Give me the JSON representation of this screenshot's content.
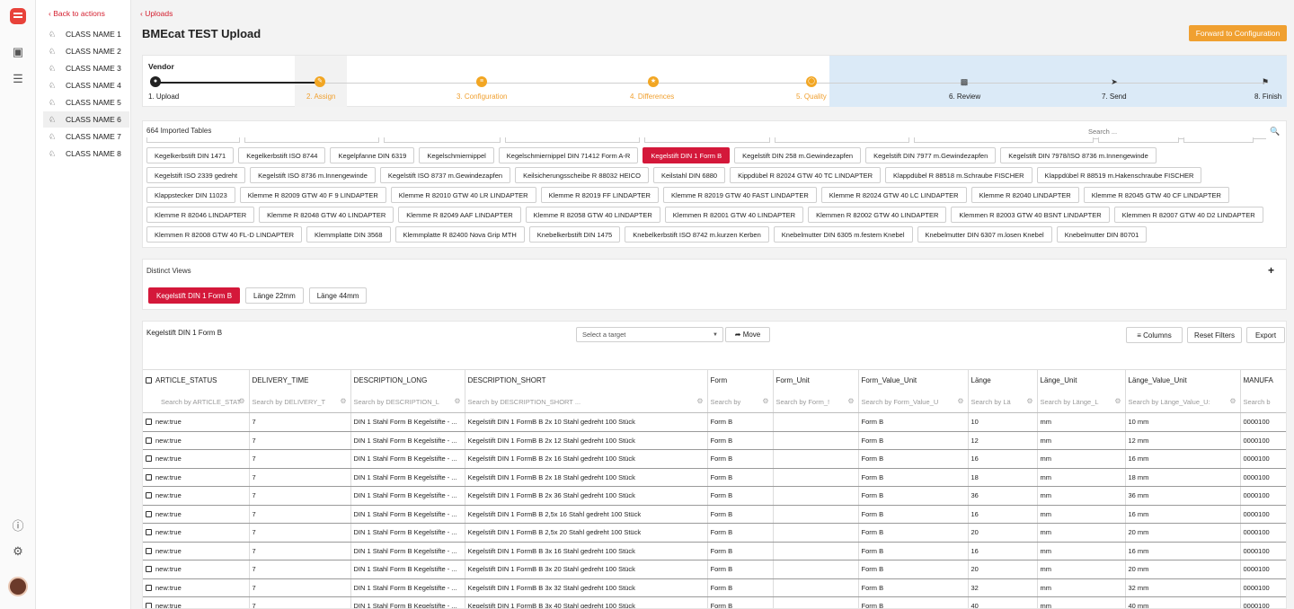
{
  "sidebar": {
    "back_label": "‹ Back to actions",
    "classes": [
      "CLASS NAME 1",
      "CLASS NAME 2",
      "CLASS NAME 3",
      "CLASS NAME 4",
      "CLASS NAME 5",
      "CLASS NAME 6",
      "CLASS NAME 7",
      "CLASS NAME 8"
    ],
    "active_class": "CLASS NAME 6"
  },
  "header": {
    "uploads_link": "‹ Uploads",
    "title": "BMEcat TEST Upload",
    "forward_button": "Forward to Configuration"
  },
  "stepper": {
    "vendor_label": "Vendor",
    "steps": [
      "1. Upload",
      "2. Assign",
      "3. Configuration",
      "4. Differences",
      "5. Quality",
      "6. Review",
      "7. Send",
      "8. Finish"
    ]
  },
  "tables": {
    "header": "664 Imported Tables",
    "search_placeholder": "Search ...",
    "rows": [
      [
        "Kegelkerbstift DIN 1471",
        "Kegelkerbstift ISO 8744",
        "Kegelpfanne DIN 6319",
        "Kegelschmiernippel",
        "Kegelschmiernippel DIN 71412 Form A-R",
        "Kegelstift DIN 1 Form B",
        "Kegelstift DIN 258 m.Gewindezapfen",
        "Kegelstift DIN 7977 m.Gewindezapfen",
        "Kegelstift DIN 7978/ISO 8736 m.Innengewinde"
      ],
      [
        "Kegelstift ISO 2339 gedreht",
        "Kegelstift ISO 8736 m.Innengewinde",
        "Kegelstift ISO 8737 m.Gewindezapfen",
        "Keilsicherungsscheibe R 88032 HEICO",
        "Keilstahl DIN 6880",
        "Kippdübel R 82024 GTW 40 TC LINDAPTER",
        "Klappdübel R 88518 m.Schraube FISCHER",
        "Klappdübel R 88519 m.Hakenschraube FISCHER"
      ],
      [
        "Klappstecker DIN 11023",
        "Klemme R 82009 GTW 40 F 9 LINDAPTER",
        "Klemme R 82010 GTW 40 LR LINDAPTER",
        "Klemme R 82019 FF LINDAPTER",
        "Klemme R 82019 GTW 40 FAST LINDAPTER",
        "Klemme R 82024 GTW 40 LC LINDAPTER",
        "Klemme R 82040 LINDAPTER",
        "Klemme R 82045 GTW 40 CF LINDAPTER"
      ],
      [
        "Klemme R 82046 LINDAPTER",
        "Klemme R 82048 GTW 40 LINDAPTER",
        "Klemme R 82049 AAF LINDAPTER",
        "Klemme R 82058 GTW 40 LINDAPTER",
        "Klemmen R 82001 GTW 40 LINDAPTER",
        "Klemmen R 82002 GTW 40 LINDAPTER",
        "Klemmen R 82003 GTW 40 BSNT LINDAPTER",
        "Klemmen R 82007 GTW 40 D2 LINDAPTER"
      ],
      [
        "Klemmen R 82008 GTW 40 FL-D LINDAPTER",
        "Klemmplatte DIN 3568",
        "Klemmplatte R 82400 Nova Grip MTH",
        "Knebelkerbstift DIN 1475",
        "Knebelkerbstift ISO 8742 m.kurzen Kerben",
        "Knebelmutter DIN 6305 m.festem Knebel",
        "Knebelmutter DIN 6307 m.losen Knebel",
        "Knebelmutter DIN 80701"
      ]
    ],
    "active_tag": "Kegelstift DIN 1 Form B"
  },
  "views": {
    "header": "Distinct Views",
    "add_icon": "+",
    "buttons": [
      "Kegelstift DIN 1 Form B",
      "Länge 22mm",
      "Länge 44mm"
    ]
  },
  "grid": {
    "title": "Kegelstift DIN 1 Form B",
    "target_placeholder": "Select a target",
    "move_label": "Move",
    "columns_label": "Columns",
    "reset_label": "Reset Filters",
    "export_label": "Export",
    "columns": [
      "ARTICLE_STATUS",
      "DELIVERY_TIME",
      "DESCRIPTION_LONG",
      "DESCRIPTION_SHORT",
      "Form",
      "Form_Unit",
      "Form_Value_Unit",
      "Länge",
      "Länge_Unit",
      "Länge_Value_Unit",
      "MANUFA"
    ],
    "filters": [
      "Search by ARTICLE_STAT",
      "Search by DELIVERY_T",
      "Search by DESCRIPTION_L",
      "Search by DESCRIPTION_SHORT ...",
      "Search by",
      "Search by Form_!",
      "Search by Form_Value_U",
      "Search by Lä",
      "Search by Länge_L",
      "Search by Länge_Value_U:",
      "Search b"
    ],
    "rows": [
      [
        "new:true",
        "7",
        "DIN 1 Stahl Form B Kegelstifte - ...",
        "Kegelstift DIN 1 FormB B 2x 10 Stahl gedreht 100 Stück",
        "Form B",
        "",
        "Form B",
        "10",
        "mm",
        "10 mm",
        "0000100"
      ],
      [
        "new:true",
        "7",
        "DIN 1 Stahl Form B Kegelstifte - ...",
        "Kegelstift DIN 1 FormB B 2x 12 Stahl gedreht 100 Stück",
        "Form B",
        "",
        "Form B",
        "12",
        "mm",
        "12 mm",
        "0000100"
      ],
      [
        "new:true",
        "7",
        "DIN 1 Stahl Form B Kegelstifte - ...",
        "Kegelstift DIN 1 FormB B 2x 16 Stahl gedreht 100 Stück",
        "Form B",
        "",
        "Form B",
        "16",
        "mm",
        "16 mm",
        "0000100"
      ],
      [
        "new:true",
        "7",
        "DIN 1 Stahl Form B Kegelstifte - ...",
        "Kegelstift DIN 1 FormB B 2x 18 Stahl gedreht 100 Stück",
        "Form B",
        "",
        "Form B",
        "18",
        "mm",
        "18 mm",
        "0000100"
      ],
      [
        "new:true",
        "7",
        "DIN 1 Stahl Form B Kegelstifte - ...",
        "Kegelstift DIN 1 FormB B 2x 36 Stahl gedreht 100 Stück",
        "Form B",
        "",
        "Form B",
        "36",
        "mm",
        "36 mm",
        "0000100"
      ],
      [
        "new:true",
        "7",
        "DIN 1 Stahl Form B Kegelstifte - ...",
        "Kegelstift DIN 1 FormB B 2,5x 16 Stahl gedreht 100 Stück",
        "Form B",
        "",
        "Form B",
        "16",
        "mm",
        "16 mm",
        "0000100"
      ],
      [
        "new:true",
        "7",
        "DIN 1 Stahl Form B Kegelstifte - ...",
        "Kegelstift DIN 1 FormB B 2,5x 20 Stahl gedreht 100 Stück",
        "Form B",
        "",
        "Form B",
        "20",
        "mm",
        "20 mm",
        "0000100"
      ],
      [
        "new:true",
        "7",
        "DIN 1 Stahl Form B Kegelstifte - ...",
        "Kegelstift DIN 1 FormB B 3x 16 Stahl gedreht 100 Stück",
        "Form B",
        "",
        "Form B",
        "16",
        "mm",
        "16 mm",
        "0000100"
      ],
      [
        "new:true",
        "7",
        "DIN 1 Stahl Form B Kegelstifte - ...",
        "Kegelstift DIN 1 FormB B 3x 20 Stahl gedreht 100 Stück",
        "Form B",
        "",
        "Form B",
        "20",
        "mm",
        "20 mm",
        "0000100"
      ],
      [
        "new:true",
        "7",
        "DIN 1 Stahl Form B Kegelstifte - ...",
        "Kegelstift DIN 1 FormB B 3x 32 Stahl gedreht 100 Stück",
        "Form B",
        "",
        "Form B",
        "32",
        "mm",
        "32 mm",
        "0000100"
      ],
      [
        "new:true",
        "7",
        "DIN 1 Stahl Form B Kegelstifte - ...",
        "Kegelstift DIN 1 FormB B 3x 40 Stahl gedreht 100 Stück",
        "Form B",
        "",
        "Form B",
        "40",
        "mm",
        "40 mm",
        "0000100"
      ]
    ]
  },
  "colors": {
    "accent_red": "#d4183a",
    "orange": "#f0a030",
    "step_highlight": "#dbeaf7"
  }
}
